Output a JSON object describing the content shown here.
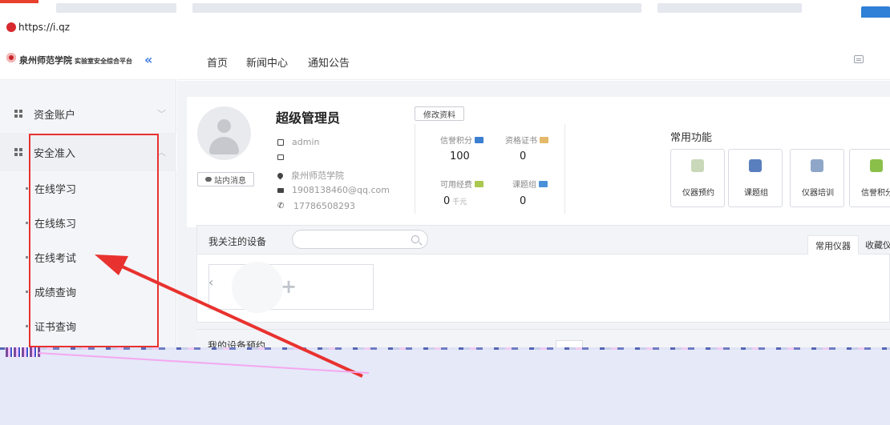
{
  "browser": {
    "url": "https://i.qz"
  },
  "sidebar": {
    "logo_title": "泉州师范学院",
    "logo_subtitle": "实验室安全综合平台",
    "collapse_icon": "«",
    "items": [
      {
        "label": "资金账户"
      },
      {
        "label": "安全准入"
      }
    ],
    "sub_items": [
      {
        "label": "在线学习"
      },
      {
        "label": "在线练习"
      },
      {
        "label": "在线考试"
      },
      {
        "label": "成绩查询"
      },
      {
        "label": "证书查询"
      }
    ]
  },
  "topnav": {
    "links": [
      {
        "label": "首页"
      },
      {
        "label": "新闻中心"
      },
      {
        "label": "通知公告"
      }
    ]
  },
  "profile": {
    "name": "超级管理员",
    "username": "admin",
    "org": "泉州师范学院",
    "email": "1908138460@qq.com",
    "phone": "17786508293",
    "inbox_label": "站内消息",
    "edit_label": "修改资料",
    "stats": [
      {
        "label": "信誉积分",
        "value": "100",
        "color": "#3b7fd1"
      },
      {
        "label": "资格证书",
        "value": "0",
        "color": "#e5b96a"
      },
      {
        "label": "可用经费",
        "value": "0",
        "unit": "千元",
        "color": "#a8c850"
      },
      {
        "label": "课题组",
        "value": "0",
        "color": "#4a90d9"
      }
    ]
  },
  "functions": {
    "title": "常用功能",
    "items": [
      {
        "label": "仪器预约",
        "icon": "clock-icon",
        "color": "#c8d8b8"
      },
      {
        "label": "课题组",
        "icon": "group-icon",
        "color": "#5a7fbe"
      },
      {
        "label": "仪器培训",
        "icon": "chalkboard-icon",
        "color": "#8fa6c8"
      },
      {
        "label": "信誉积分",
        "icon": "pencil-icon",
        "color": "#8ac04a"
      }
    ]
  },
  "watch": {
    "title": "我关注的设备",
    "search_placeholder": "",
    "tabs": [
      {
        "label": "常用仪器",
        "active": true
      },
      {
        "label": "收藏仪器",
        "active": false
      }
    ]
  },
  "booking": {
    "title": "我的设备预约"
  }
}
